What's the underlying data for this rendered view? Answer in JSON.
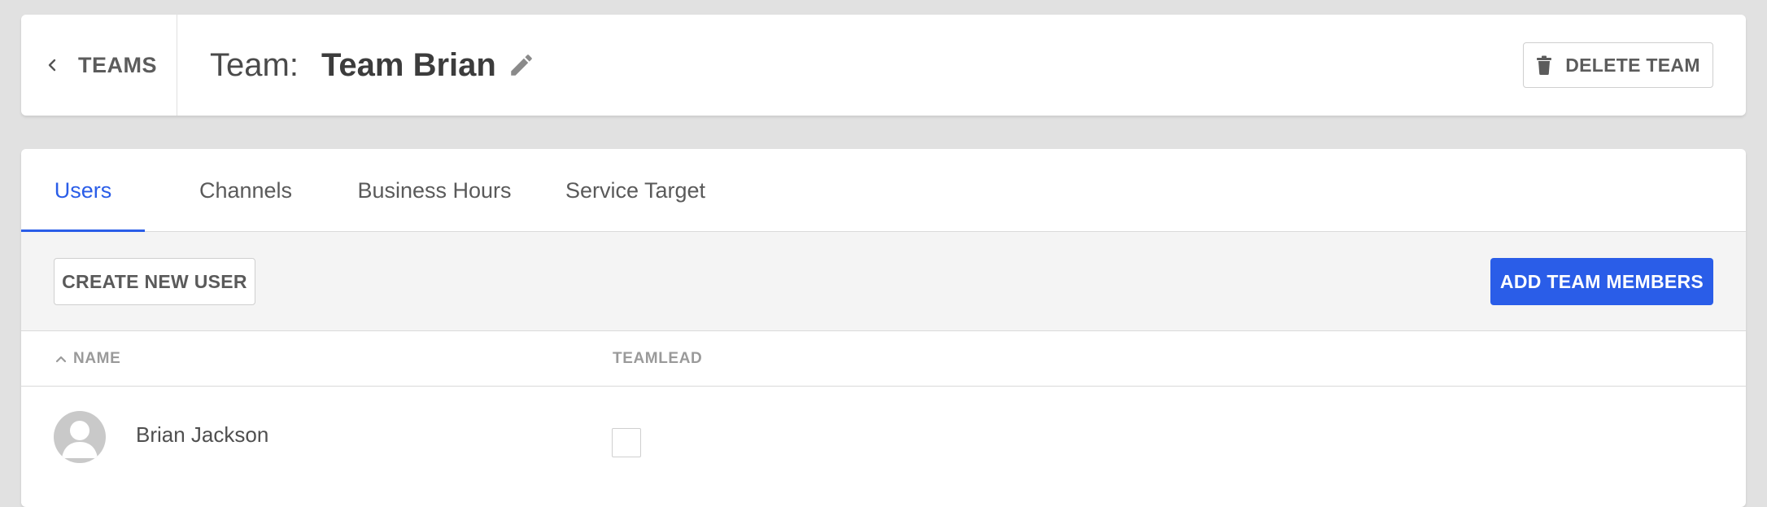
{
  "header": {
    "back_label": "TEAMS",
    "team_prefix": "Team:",
    "team_name": "Team Brian",
    "delete_label": "DELETE TEAM"
  },
  "tabs": [
    {
      "label": "Users",
      "active": true
    },
    {
      "label": "Channels",
      "active": false
    },
    {
      "label": "Business Hours",
      "active": false
    },
    {
      "label": "Service Target",
      "active": false
    }
  ],
  "toolbar": {
    "create_user_label": "CREATE NEW USER",
    "add_members_label": "ADD TEAM MEMBERS"
  },
  "table": {
    "columns": [
      "NAME",
      "TEAMLEAD"
    ],
    "sort": {
      "column": "NAME",
      "direction": "ascending"
    },
    "rows": [
      {
        "name": "Brian Jackson",
        "teamlead": false
      }
    ]
  },
  "colors": {
    "accent": "#2a5de8",
    "background": "#e1e1e1",
    "toolbar_bg": "#f4f4f4"
  },
  "icons": {
    "back": "chevron-left-icon",
    "edit": "pencil-icon",
    "delete": "trash-icon",
    "sort": "chevron-up-icon",
    "avatar": "user-avatar-icon"
  }
}
